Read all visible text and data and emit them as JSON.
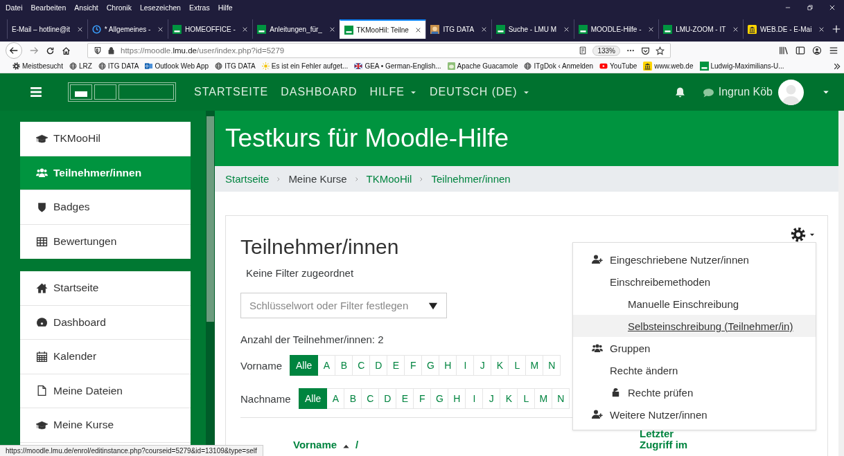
{
  "menu_bar": [
    "Datei",
    "Bearbeiten",
    "Ansicht",
    "Chronik",
    "Lesezeichen",
    "Extras",
    "Hilfe"
  ],
  "tabs": [
    {
      "label": "E-Mail – hotline@it",
      "selected": false
    },
    {
      "label": "* Allgemeines -",
      "selected": false
    },
    {
      "label": "HOMEOFFICE -",
      "selected": false
    },
    {
      "label": "Anleitungen_für_",
      "selected": false
    },
    {
      "label": "TKMooHil: Teilne",
      "selected": true
    },
    {
      "label": "ITG DATA",
      "selected": false
    },
    {
      "label": "Suche - LMU M",
      "selected": false
    },
    {
      "label": "MOODLE-Hilfe -",
      "selected": false
    },
    {
      "label": "LMU-ZOOM - IT",
      "selected": false
    },
    {
      "label": "WEB.DE - E-Mai",
      "selected": false
    }
  ],
  "address_bar": {
    "url_prefix": "https://moodle.",
    "url_domain": "lmu.de",
    "url_path": "/user/index.php?id=5279",
    "zoom": "133%"
  },
  "bookmarks": [
    "Meistbesucht",
    "LRZ",
    "ITG DATA",
    "Outlook Web App",
    "ITG DATA",
    "Es ist ein Fehler aufget...",
    "GEA • German-English...",
    "Apache Guacamole",
    "ITgDok ‹ Anmelden",
    "YouTube",
    "www.web.de",
    "Ludwig-Maximilians-U..."
  ],
  "moodle_nav": {
    "items": [
      {
        "label": "STARTSEITE",
        "dropdown": false
      },
      {
        "label": "DASHBOARD",
        "dropdown": false
      },
      {
        "label": "HILFE",
        "dropdown": true
      },
      {
        "label": "DEUTSCH (DE)",
        "dropdown": true
      }
    ],
    "user": "Ingrun Köb"
  },
  "sidebar": {
    "groups": [
      {
        "items": [
          {
            "label": "TKMooHil",
            "selected": false
          },
          {
            "label": "Teilnehmer/innen",
            "selected": true
          },
          {
            "label": "Badges",
            "selected": false
          },
          {
            "label": "Bewertungen",
            "selected": false
          }
        ]
      },
      {
        "items": [
          {
            "label": "Startseite",
            "selected": false
          },
          {
            "label": "Dashboard",
            "selected": false
          },
          {
            "label": "Kalender",
            "selected": false
          },
          {
            "label": "Meine Dateien",
            "selected": false
          },
          {
            "label": "Meine Kurse",
            "selected": false
          }
        ]
      }
    ]
  },
  "course": {
    "title": "Testkurs für Moodle-Hilfe",
    "breadcrumb": [
      {
        "label": "Startseite",
        "kind": "link"
      },
      {
        "label": "Meine Kurse",
        "kind": "text"
      },
      {
        "label": "TKMooHil",
        "kind": "link"
      },
      {
        "label": "Teilnehmer/innen",
        "kind": "link"
      }
    ]
  },
  "participants": {
    "title": "Teilnehmer/innen",
    "filter_status": "Keine Filter zugeordnet",
    "filter": {
      "placeholder": "Schlüsselwort oder Filter festlegen"
    },
    "count": "Anzahl der Teilnehmer/innen: 2",
    "initials_bars": [
      {
        "label": "Vorname",
        "letters": [
          {
            "label": "Alle",
            "selected": true
          },
          {
            "label": "A",
            "selected": false
          },
          {
            "label": "B",
            "selected": false
          },
          {
            "label": "C",
            "selected": false
          },
          {
            "label": "D",
            "selected": false
          },
          {
            "label": "E",
            "selected": false
          },
          {
            "label": "F",
            "selected": false
          },
          {
            "label": "G",
            "selected": false
          },
          {
            "label": "H",
            "selected": false
          },
          {
            "label": "I",
            "selected": false
          },
          {
            "label": "J",
            "selected": false
          },
          {
            "label": "K",
            "selected": false
          },
          {
            "label": "L",
            "selected": false
          },
          {
            "label": "M",
            "selected": false
          },
          {
            "label": "N",
            "selected": false
          }
        ]
      },
      {
        "label": "Nachname",
        "letters": [
          {
            "label": "Alle",
            "selected": true
          },
          {
            "label": "A",
            "selected": false
          },
          {
            "label": "B",
            "selected": false
          },
          {
            "label": "C",
            "selected": false
          },
          {
            "label": "D",
            "selected": false
          },
          {
            "label": "E",
            "selected": false
          },
          {
            "label": "F",
            "selected": false
          },
          {
            "label": "G",
            "selected": false
          },
          {
            "label": "H",
            "selected": false
          },
          {
            "label": "I",
            "selected": false
          },
          {
            "label": "J",
            "selected": false
          },
          {
            "label": "K",
            "selected": false
          },
          {
            "label": "L",
            "selected": false
          },
          {
            "label": "M",
            "selected": false
          },
          {
            "label": "N",
            "selected": false
          }
        ]
      }
    ],
    "columns": [
      {
        "label": "Vorname",
        "sorted": true,
        "separator": "/"
      },
      {
        "label": "Letzter Zugriff im",
        "sorted": false
      }
    ]
  },
  "actions_menu": {
    "items": [
      {
        "label": "Eingeschriebene Nutzer/innen",
        "selected": false
      },
      {
        "label": "Einschreibemethoden",
        "selected": false,
        "children": [
          {
            "label": "Manuelle Einschreibung",
            "selected": false
          },
          {
            "label": "Selbsteinschreibung (Teilnehmer/in)",
            "selected": true
          }
        ]
      },
      {
        "label": "Gruppen",
        "selected": false
      },
      {
        "label": "Rechte ändern",
        "selected": false,
        "children": [
          {
            "label": "Rechte prüfen",
            "selected": false
          }
        ]
      },
      {
        "label": "Weitere Nutzer/innen",
        "selected": false
      }
    ]
  },
  "status_url": "https://moodle.lmu.de/enrol/editinstance.php?courseid=5279&id=13109&type=self"
}
